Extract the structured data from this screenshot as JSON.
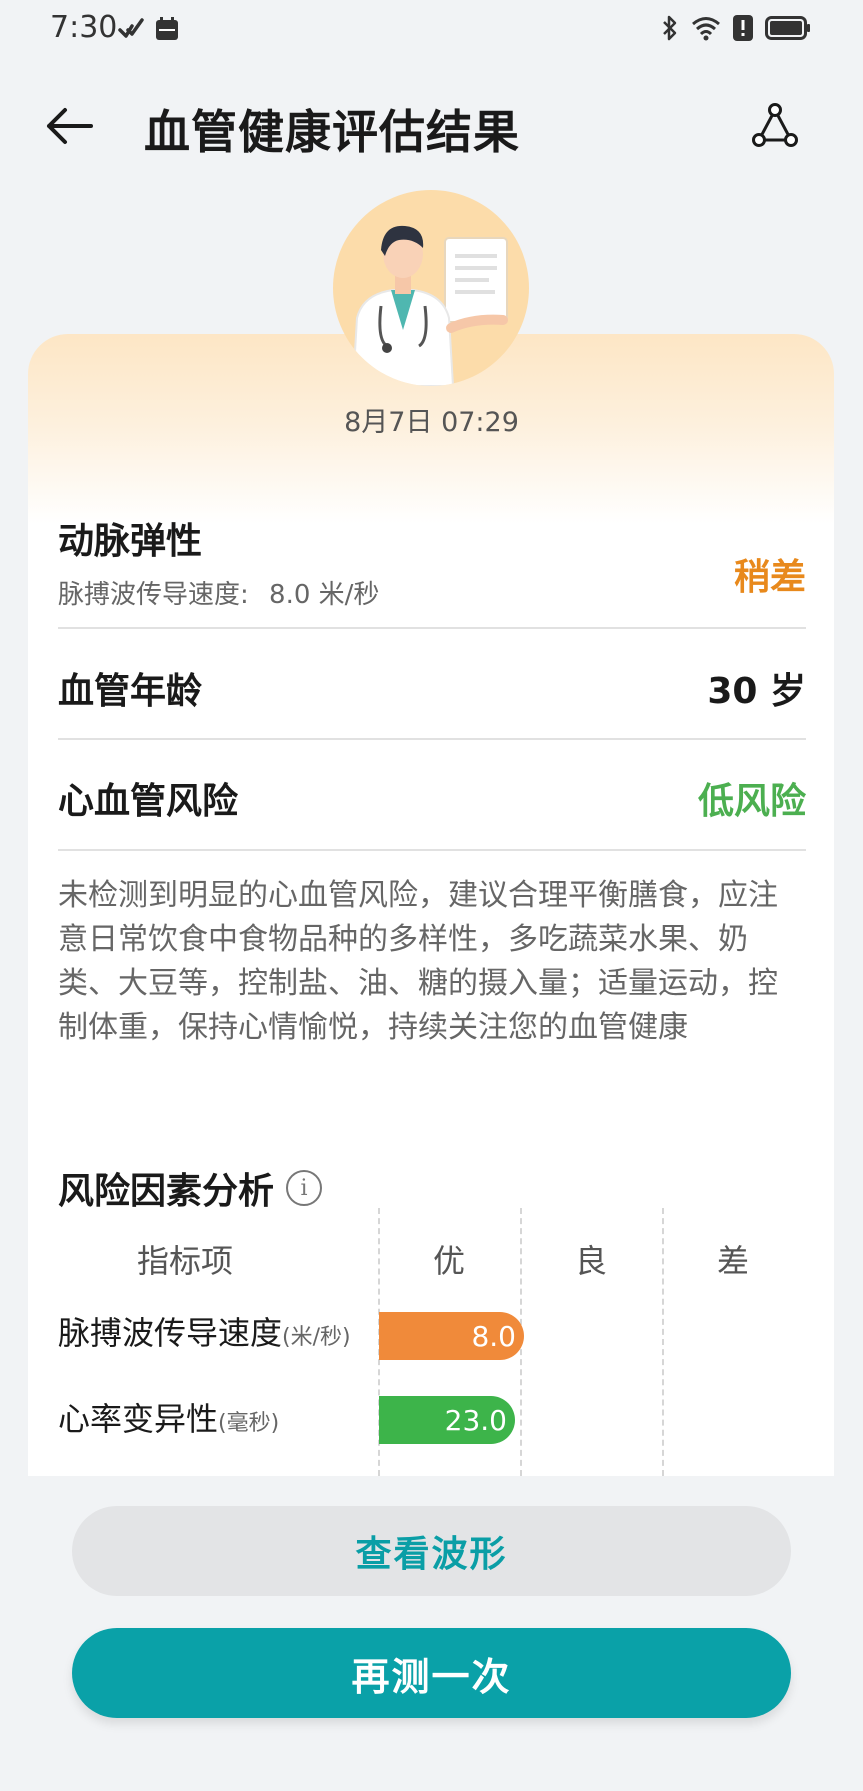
{
  "status_bar": {
    "time": "7:30",
    "icons": [
      "huawei-share-icon",
      "huawei-app-icon",
      "bluetooth-icon",
      "wifi-icon",
      "alert-icon",
      "battery-icon"
    ]
  },
  "header": {
    "title": "血管健康评估结果",
    "back_icon": "arrow-left-icon",
    "share_icon": "share-icon"
  },
  "result": {
    "datetime": "8月7日 07:29",
    "arterial_elasticity": {
      "label": "动脉弹性",
      "detail_label": "脉搏波传导速度:",
      "detail_value": "8.0 米/秒",
      "status": "稍差",
      "status_color": "#e8891c"
    },
    "vascular_age": {
      "label": "血管年龄",
      "value": "30 岁"
    },
    "cardio_risk": {
      "label": "心血管风险",
      "value": "低风险",
      "value_color": "#4caf50"
    },
    "advice": "未检测到明显的心血管风险，建议合理平衡膳食，应注意日常饮食中食物品种的多样性，多吃蔬菜水果、奶类、大豆等，控制盐、油、糖的摄入量；适量运动，控制体重，保持心情愉悦，持续关注您的血管健康"
  },
  "risk_factors": {
    "title": "风险因素分析",
    "info_icon": "info-icon",
    "columns": [
      "指标项",
      "优",
      "良",
      "差"
    ],
    "metrics": [
      {
        "name": "脉搏波传导速度",
        "unit": "(米/秒)",
        "value": "8.0",
        "bar_fraction": 0.34,
        "color": "#f08a3a"
      },
      {
        "name": "心率变异性",
        "unit": "(毫秒)",
        "value": "23.0",
        "bar_fraction": 0.32,
        "color": "#3db44a"
      }
    ]
  },
  "actions": {
    "view_waveform": "查看波形",
    "measure_again": "再测一次"
  }
}
